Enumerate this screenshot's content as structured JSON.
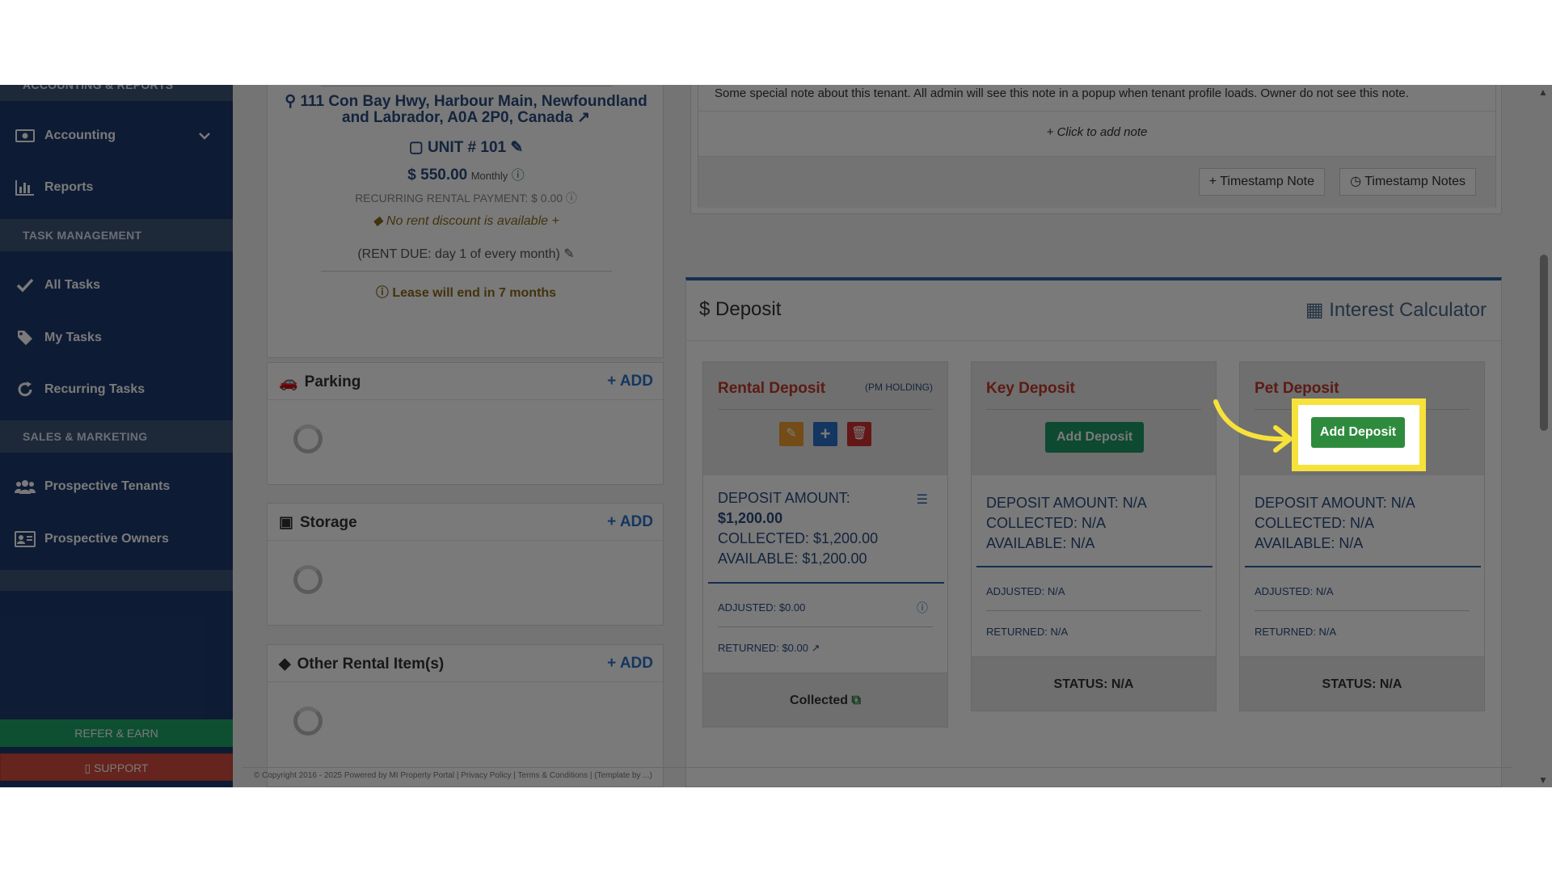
{
  "sidebar": {
    "section_accounting": "ACCOUNTING & REPORTS",
    "accounting": "Accounting",
    "reports": "Reports",
    "section_task": "TASK MANAGEMENT",
    "all_tasks": "All Tasks",
    "my_tasks": "My Tasks",
    "recurring_tasks": "Recurring Tasks",
    "section_sales": "SALES & MARKETING",
    "prospective_tenants": "Prospective Tenants",
    "prospective_owners": "Prospective Owners",
    "refer_earn": "REFER & EARN",
    "support": "SUPPORT"
  },
  "details": {
    "address": "111 Con Bay Hwy, Harbour Main, Newfoundland and Labrador, A0A 2P0, Canada",
    "unit": "UNIT # 101",
    "rent": "$ 550.00",
    "rent_period": "Monthly",
    "recurring": "RECURRING RENTAL PAYMENT: $ 0.00",
    "discount": "No rent discount is available",
    "due": "(RENT DUE: day 1 of every month)",
    "lease": "Lease will end in 7 months"
  },
  "boxes": {
    "parking": "Parking",
    "storage": "Storage",
    "other": "Other Rental Item(s)",
    "add": "ADD"
  },
  "notes": {
    "text": "Some special note about this tenant. All admin will see this note in a popup when tenant profile loads. Owner do not see this note.",
    "click_add": "Click to add note",
    "timestamp_note": "Timestamp Note",
    "timestamp_notes": "Timestamp Notes"
  },
  "deposit": {
    "title": "Deposit",
    "calculator": "Interest Calculator",
    "rental": {
      "title": "Rental Deposit",
      "holding": "(PM HOLDING)",
      "amount_label": "DEPOSIT AMOUNT:",
      "amount": "$1,200.00",
      "collected": "COLLECTED: $1,200.00",
      "available": "AVAILABLE: $1,200.00",
      "adjusted": "ADJUSTED: $0.00",
      "returned": "RETURNED: $0.00",
      "status": "Collected"
    },
    "key": {
      "title": "Key Deposit",
      "button": "Add Deposit",
      "amount": "DEPOSIT AMOUNT: N/A",
      "collected": "COLLECTED: N/A",
      "available": "AVAILABLE: N/A",
      "adjusted": "ADJUSTED: N/A",
      "returned": "RETURNED: N/A",
      "status": "STATUS: N/A"
    },
    "pet": {
      "title": "Pet Deposit",
      "button": "Add Deposit",
      "amount": "DEPOSIT AMOUNT: N/A",
      "collected": "COLLECTED: N/A",
      "available": "AVAILABLE: N/A",
      "adjusted": "ADJUSTED: N/A",
      "returned": "RETURNED: N/A",
      "status": "STATUS: N/A"
    }
  },
  "footer": "© Copyright 2016 - 2025 Powered by MI Property Portal | Privacy Policy | Terms & Conditions | (Template by ...)",
  "colors": {
    "sidebar": "#1e3a6e",
    "highlight": "#f7e13b",
    "button_green": "#2e8b3d",
    "deposit_title": "#c0392b"
  }
}
